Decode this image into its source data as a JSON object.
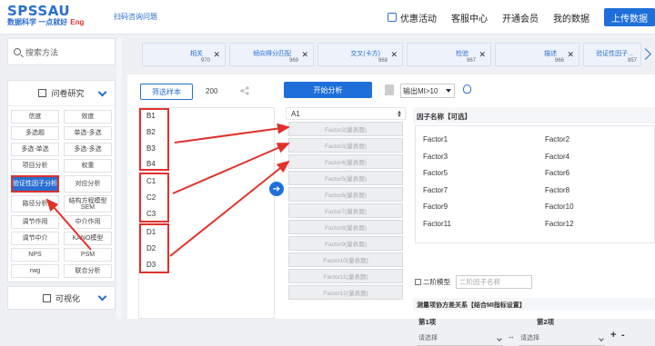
{
  "header": {
    "logo": "SPSSAU",
    "logo_sub": "数据科学 一点就好",
    "logo_eng": "Eng",
    "scan_link": "扫码咨询问题",
    "nav": [
      "优惠活动",
      "客服中心",
      "开通会员",
      "我的数据"
    ],
    "upload_btn": "上传数据"
  },
  "sidebar": {
    "search_placeholder": "搜索方法",
    "panel_title": "问卷研究",
    "methods": [
      "信度",
      "效度",
      "多选题",
      "单选-多选",
      "多选-单选",
      "多选-多选",
      "项目分析",
      "权重",
      "验证性因子分析",
      "对应分析",
      "路径分析",
      "结构方程模型SEM",
      "调节作用",
      "中介作用",
      "调节中介",
      "KANO模型",
      "NPS",
      "PSM",
      "rwg",
      "联合分析"
    ],
    "visual_title": "可视化"
  },
  "tabs": [
    {
      "name": "相关",
      "num": "970"
    },
    {
      "name": "倾向得分匹配",
      "num": "969"
    },
    {
      "name": "交叉(卡方)",
      "num": "968"
    },
    {
      "name": "检验",
      "num": "967"
    },
    {
      "name": "描述",
      "num": "966"
    },
    {
      "name": "验证性因子...",
      "num": "957"
    }
  ],
  "toolbar": {
    "filter_btn": "筛选样本",
    "sample_count": "200",
    "analyze_btn": "开始分析",
    "output_select": "输出MI>10"
  },
  "variables": [
    "B1",
    "B2",
    "B3",
    "B4",
    "C1",
    "C2",
    "C3",
    "D1",
    "D2",
    "D3"
  ],
  "drop": {
    "header": "A1",
    "factors": [
      "Factor2(量表题)",
      "Factor3(量表题)",
      "Factor4(量表题)",
      "Factor5(量表题)",
      "Factor6(量表题)",
      "Factor7(量表题)",
      "Factor8(量表题)",
      "Factor9(量表题)",
      "Factor10(量表题)",
      "Factor11(量表题)",
      "Factor12(量表题)"
    ]
  },
  "factor_names": {
    "title": "因子名称【可选】",
    "left": [
      "Factor1",
      "Factor3",
      "Factor5",
      "Factor7",
      "Factor9",
      "Factor11"
    ],
    "right": [
      "Factor2",
      "Factor4",
      "Factor6",
      "Factor8",
      "Factor10",
      "Factor12"
    ]
  },
  "second_order": {
    "label": "二阶模型",
    "placeholder": "二阶因子名称"
  },
  "covariance": {
    "title": "测量项协方差关系【结合MI指标设置】",
    "item1": "第1项",
    "item2": "第2项",
    "select_placeholder": "请选择"
  },
  "colors": {
    "accent": "#1e6fd9",
    "highlight": "#e0322b"
  }
}
